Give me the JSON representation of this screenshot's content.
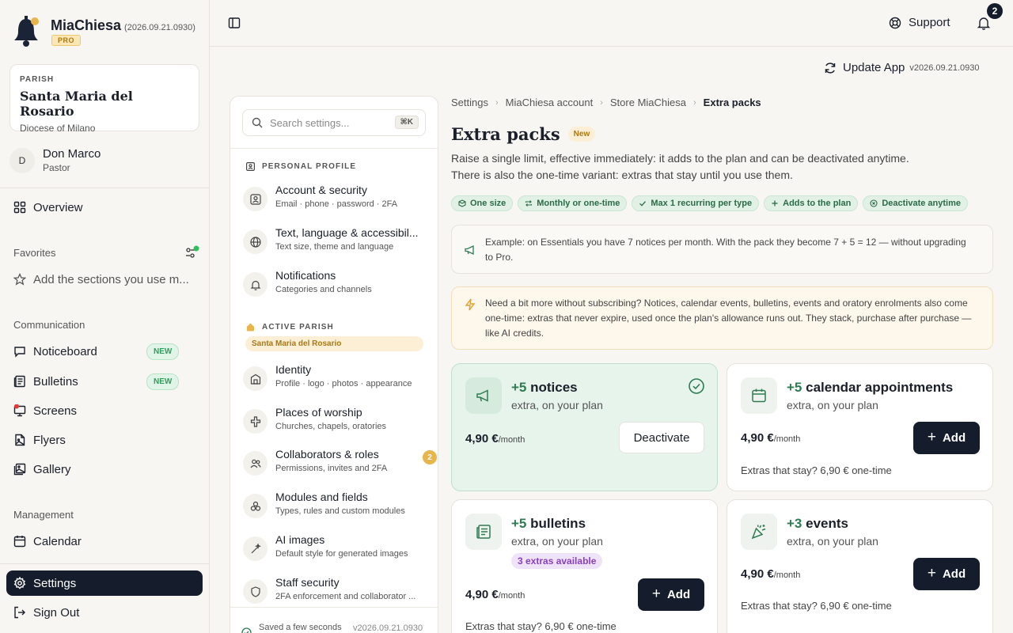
{
  "brand": {
    "name": "MiaChiesa",
    "version": "(2026.09.21.0930)",
    "tier": "PRO"
  },
  "parish": {
    "label": "PARISH",
    "name": "Santa Maria del Rosario",
    "diocese": "Diocese of Milano"
  },
  "user": {
    "initial": "D",
    "name": "Don Marco",
    "role": "Pastor"
  },
  "sidebar": {
    "overview": "Overview",
    "favorites_label": "Favorites",
    "favorites_hint": "Add the sections you use m...",
    "communication_label": "Communication",
    "communication": [
      {
        "label": "Noticeboard",
        "badge": "NEW"
      },
      {
        "label": "Bulletins",
        "badge": "NEW"
      },
      {
        "label": "Screens",
        "badge": ""
      },
      {
        "label": "Flyers",
        "badge": ""
      },
      {
        "label": "Gallery",
        "badge": ""
      }
    ],
    "management_label": "Management",
    "calendar": "Calendar",
    "settings": "Settings",
    "signout": "Sign Out"
  },
  "topbar": {
    "support": "Support",
    "notifications_count": "2",
    "update_label": "Update App",
    "update_version": "v2026.09.21.0930"
  },
  "settings_panel": {
    "search_placeholder": "Search settings...",
    "search_shortcut": "⌘K",
    "personal_heading": "PERSONAL PROFILE",
    "personal": [
      {
        "title": "Account & security",
        "sub": "Email · phone · password · 2FA"
      },
      {
        "title": "Text, language & accessibil...",
        "sub": "Text size, theme and language"
      },
      {
        "title": "Notifications",
        "sub": "Categories and channels"
      }
    ],
    "parish_heading": "ACTIVE PARISH",
    "parish_name": "Santa Maria del Rosario",
    "parish_items": [
      {
        "title": "Identity",
        "sub": "Profile · logo · photos · appearance"
      },
      {
        "title": "Places of worship",
        "sub": "Churches, chapels, oratories"
      },
      {
        "title": "Collaborators & roles",
        "sub": "Permissions, invites and 2FA",
        "count": "2"
      },
      {
        "title": "Modules and fields",
        "sub": "Types, rules and custom modules"
      },
      {
        "title": "AI images",
        "sub": "Default style for generated images"
      },
      {
        "title": "Staff security",
        "sub": "2FA enforcement and collaborator ..."
      }
    ],
    "saved": "Saved a few seconds",
    "version": "v2026.09.21.0930"
  },
  "breadcrumb": [
    "Settings",
    "MiaChiesa account",
    "Store MiaChiesa",
    "Extra packs"
  ],
  "page": {
    "title": "Extra packs",
    "title_badge": "New",
    "desc1": "Raise a single limit, effective immediately: it adds to the plan and can be deactivated anytime.",
    "desc2": "There is also the one-time variant: extras that stay until you use them.",
    "chips": [
      "One size",
      "Monthly or one-time",
      "Max 1 recurring per type",
      "Adds to the plan",
      "Deactivate anytime"
    ],
    "example": "Example: on Essentials you have 7 notices per month. With the pack they become 7 + 5 = 12 — without upgrading to Pro.",
    "tip": "Need a bit more without subscribing? Notices, calendar events, bulletins, events and oratory enrolments also come one-time: extras that never expire, used once the plan's allowance runs out. They stack, purchase after purchase — like AI credits."
  },
  "cards": [
    {
      "plus": "+5",
      "name": "notices",
      "sub": "extra, on your plan",
      "price": "4,90 €",
      "per": "/month",
      "action": "Deactivate",
      "note": ""
    },
    {
      "plus": "+5",
      "name": "calendar appointments",
      "sub": "extra, on your plan",
      "price": "4,90 €",
      "per": "/month",
      "action": "Add",
      "note": "Extras that stay? 6,90 € one-time"
    },
    {
      "plus": "+5",
      "name": "bulletins",
      "sub": "extra, on your plan",
      "available": "3 extras available",
      "price": "4,90 €",
      "per": "/month",
      "action": "Add",
      "note": "Extras that stay? 6,90 € one-time"
    },
    {
      "plus": "+3",
      "name": "events",
      "sub": "extra, on your plan",
      "price": "4,90 €",
      "per": "/month",
      "action": "Add",
      "note": "Extras that stay? 6,90 € one-time"
    }
  ],
  "colors": {
    "accent_dark": "#151c2c",
    "accent_green": "#2f7b52",
    "badge_gold": "#e7b54c"
  }
}
